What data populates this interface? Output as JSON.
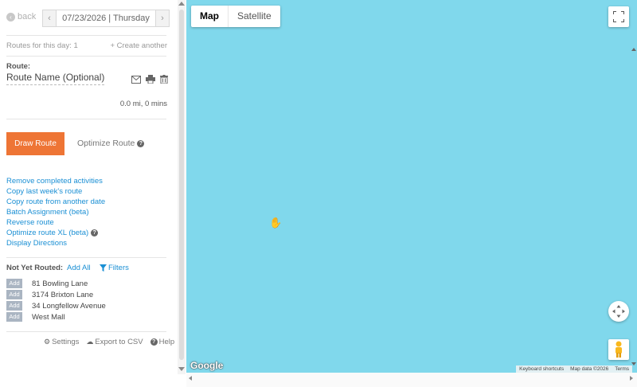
{
  "topbar": {
    "back_label": "back",
    "date": "07/23/2026 | Thursday"
  },
  "routes": {
    "count_text": "Routes for this day: 1",
    "create_another": "+ Create another"
  },
  "route": {
    "label": "Route:",
    "name": "Route Name (Optional)",
    "distance": "0.0 mi, 0 mins"
  },
  "actions": {
    "draw_route": "Draw Route",
    "optimize_route": "Optimize Route"
  },
  "links": [
    "Remove completed activities",
    "Copy last week's route",
    "Copy route from another date",
    "Batch Assignment (beta)",
    "Reverse route",
    "Optimize route XL (beta)",
    "Display Directions"
  ],
  "not_routed": {
    "label": "Not Yet Routed:",
    "add_all": "Add All",
    "filters": "Filters",
    "add_label": "Add",
    "addresses": [
      "81 Bowling Lane",
      "3174 Brixton Lane",
      "34 Longfellow Avenue",
      "West Mall"
    ]
  },
  "footer": {
    "settings": "Settings",
    "export": "Export to CSV",
    "help": "Help"
  },
  "map": {
    "type_map": "Map",
    "type_satellite": "Satellite",
    "google": "Google",
    "keyboard_shortcuts": "Keyboard shortcuts",
    "map_data": "Map data ©2026",
    "terms": "Terms",
    "water_color": "#80d8ec"
  },
  "colors": {
    "accent": "#ee7535",
    "link": "#1a8fd4"
  }
}
